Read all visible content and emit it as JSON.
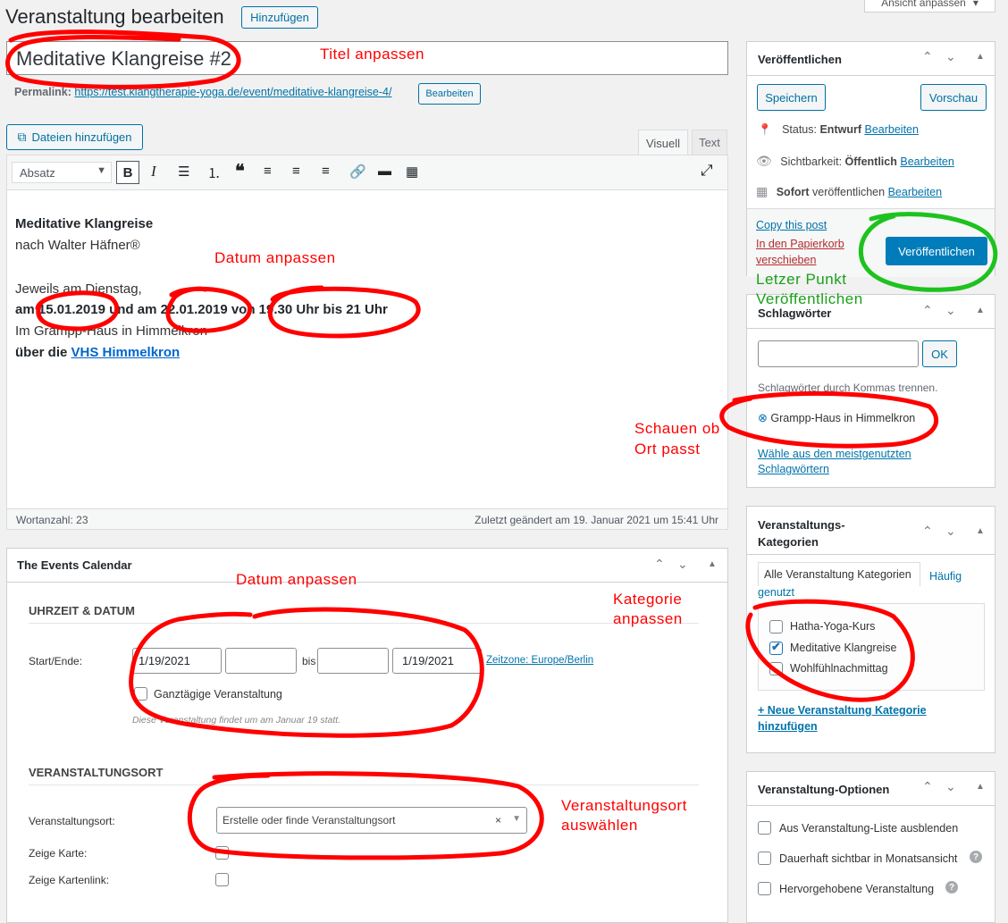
{
  "page": {
    "title": "Veranstaltung bearbeiten",
    "add_button": "Hinzufügen",
    "screen_options": "Ansicht anpassen"
  },
  "post": {
    "title": "Meditative Klangreise #2",
    "permalink_label": "Permalink:",
    "permalink_url": "https://test.klangtherapie-yoga.de/event/meditative-klangreise-4/",
    "permalink_edit": "Bearbeiten"
  },
  "editor": {
    "add_media": "Dateien hinzufügen",
    "tab_visual": "Visuell",
    "tab_text": "Text",
    "format_select": "Absatz",
    "content": {
      "line1": "Meditative Klangreise",
      "line2": "nach Walter Häfner®",
      "line3": "Jeweils am Dienstag,",
      "line4": "am 15.01.2019 und am 22.01.2019 von 19.30 Uhr bis 21 Uhr",
      "line5": "Im Grampp-Haus in Himmelkron",
      "line6_prefix": "über die ",
      "line6_link": "VHS Himmelkron"
    },
    "word_count": "Wortanzahl: 23",
    "last_edited": "Zuletzt geändert am 19. Januar 2021 um 15:41 Uhr"
  },
  "events_calendar": {
    "title": "The Events Calendar",
    "section_time": "UHRZEIT & DATUM",
    "start_end_label": "Start/Ende:",
    "start_date": "1/19/2021",
    "start_time": "",
    "bis": "bis",
    "end_time": "",
    "end_date": "1/19/2021",
    "timezone": "Zeitzone: Europe/Berlin",
    "all_day": "Ganztägige Veranstaltung",
    "note": "Diese Veranstaltung findet um am Januar 19 statt.",
    "section_venue": "VERANSTALTUNGSORT",
    "venue_label": "Veranstaltungsort:",
    "venue_placeholder": "Erstelle oder finde Veranstaltungsort",
    "show_map_label": "Zeige Karte:",
    "show_map_link_label": "Zeige Kartenlink:"
  },
  "publish": {
    "title": "Veröffentlichen",
    "save": "Speichern",
    "preview": "Vorschau",
    "status_label": "Status:",
    "status_value": "Entwurf",
    "visibility_label": "Sichtbarkeit:",
    "visibility_value": "Öffentlich",
    "schedule_bold": "Sofort",
    "schedule_rest": "veröffentlichen",
    "edit": "Bearbeiten",
    "copy_post": "Copy this post",
    "trash": "In den Papierkorb verschieben",
    "publish_button": "Veröffentlichen"
  },
  "tags": {
    "title": "Schlagwörter",
    "input_value": "",
    "ok": "OK",
    "hint": "Schlagwörter durch Kommas trennen.",
    "tag": "Grampp-Haus in Himmelkron",
    "choose": "Wähle aus den meistgenutzten Schlagwörtern"
  },
  "categories": {
    "title": "Veranstaltungs-Kategorien",
    "tab_all": "Alle Veranstaltung Kategorien",
    "tab_popular": "Häufig genutzt",
    "items": [
      {
        "label": "Hatha-Yoga-Kurs",
        "checked": false
      },
      {
        "label": "Meditative Klangreise",
        "checked": true
      },
      {
        "label": "Wohlfühlnachmittag",
        "checked": false
      }
    ],
    "add_new": "+ Neue Veranstaltung Kategorie hinzufügen"
  },
  "options": {
    "title": "Veranstaltung-Optionen",
    "items": [
      {
        "label": "Aus Veranstaltung-Liste ausblenden",
        "help": false
      },
      {
        "label": "Dauerhaft sichtbar in Monatsansicht",
        "help": true
      },
      {
        "label": "Hervorgehobene Veranstaltung",
        "help": true
      }
    ]
  },
  "annotations": {
    "title": "Titel anpassen",
    "date1": "Datum anpassen",
    "date2": "Datum anpassen",
    "location": "Schauen ob Ort passt",
    "location_l1": "Schauen ob",
    "location_l2": "Ort passt",
    "category_l1": "Kategorie",
    "category_l2": "anpassen",
    "venue_l1": "Veranstaltungsort",
    "venue_l2": "auswählen",
    "publish_l1": "Letzer Punkt",
    "publish_l2": "Veröffentlichen"
  },
  "colors": {
    "annotation_red": "#ff0000",
    "annotation_green": "#1aa01a",
    "primary": "#007cba",
    "link": "#0073aa"
  }
}
